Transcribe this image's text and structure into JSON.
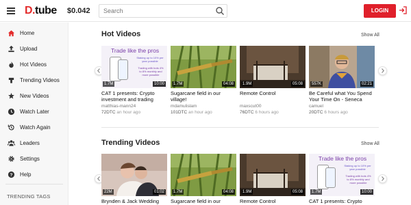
{
  "header": {
    "logo_prefix": "D.",
    "logo_text": "tube",
    "balance": "$0.042",
    "search_placeholder": "Search",
    "login_label": "LOGIN"
  },
  "sidebar": {
    "items": [
      {
        "label": "Home",
        "icon": "home-icon"
      },
      {
        "label": "Upload",
        "icon": "upload-icon"
      },
      {
        "label": "Hot Videos",
        "icon": "flame-icon"
      },
      {
        "label": "Trending Videos",
        "icon": "trending-icon"
      },
      {
        "label": "New Videos",
        "icon": "new-icon"
      },
      {
        "label": "Watch Later",
        "icon": "clock-icon"
      },
      {
        "label": "Watch Again",
        "icon": "history-icon"
      },
      {
        "label": "Leaders",
        "icon": "users-icon"
      },
      {
        "label": "Settings",
        "icon": "gear-icon"
      },
      {
        "label": "Help",
        "icon": "help-icon"
      }
    ],
    "trending_tags_label": "TRENDING TAGS"
  },
  "sections": [
    {
      "title": "Hot Videos",
      "show_all": "Show All",
      "cards": [
        {
          "title": "CAT 1 presents: Crypto investment and trading platform",
          "author": "matthias-mann24",
          "value": "72DTC",
          "ago": "an hour ago",
          "votes": "1.7M",
          "duration": "10:00",
          "thumb": "promo"
        },
        {
          "title": "Sugarcane field in our village!",
          "author": "mdamulislam",
          "value": "101DTC",
          "ago": "an hour ago",
          "votes": "1.7M",
          "duration": "04:08",
          "thumb": "sugarcane"
        },
        {
          "title": "Remote Control",
          "author": "maxscut00",
          "value": "76DTC",
          "ago": "6 hours ago",
          "votes": "1.9M",
          "duration": "05:08",
          "thumb": "room"
        },
        {
          "title": "Be Careful what You Spend Your Time On - Seneca",
          "author": "camuel",
          "value": "20DTC",
          "ago": "6 hours ago",
          "votes": "557K",
          "duration": "02:21",
          "thumb": "person"
        }
      ]
    },
    {
      "title": "Trending Videos",
      "show_all": "Show All",
      "cards": [
        {
          "title": "Brynden & Jack Wedding Teaser",
          "author": "",
          "value": "",
          "ago": "",
          "votes": "22M",
          "duration": "01:02",
          "thumb": "wedding"
        },
        {
          "title": "Sugarcane field in our village!",
          "author": "",
          "value": "",
          "ago": "",
          "votes": "1.7M",
          "duration": "04:08",
          "thumb": "sugarcane"
        },
        {
          "title": "Remote Control",
          "author": "",
          "value": "",
          "ago": "",
          "votes": "1.9M",
          "duration": "05:08",
          "thumb": "room"
        },
        {
          "title": "CAT 1 presents: Crypto",
          "author": "",
          "value": "",
          "ago": "",
          "votes": "1.7M",
          "duration": "10:00",
          "thumb": "promo"
        }
      ]
    }
  ],
  "promo": {
    "headline": "Trade like the pros",
    "line1": "Staking up to 10% per year possible",
    "line2": "Trading with bots 4% to 8% monthly and more possible"
  },
  "colors": {
    "accent": "#e0202b",
    "sidebar_bg": "#f7f7f7",
    "promo_text": "#7a3ea8"
  }
}
